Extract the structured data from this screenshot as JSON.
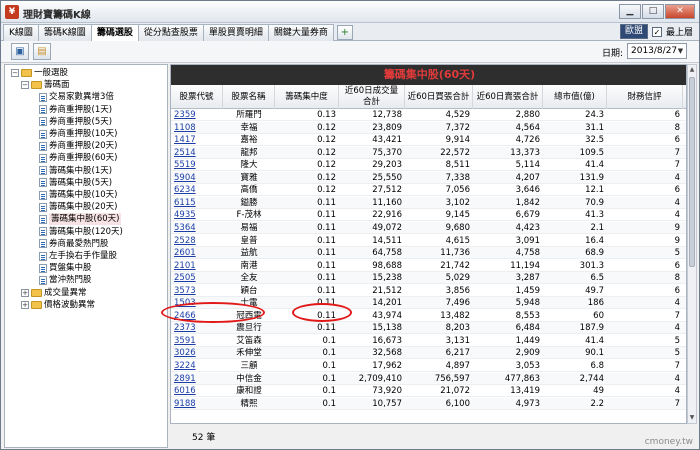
{
  "window": {
    "app_icon": "app-logo-icon",
    "title": "理財寶籌碼K線",
    "buttons": [
      "minimize-icon",
      "maximize-icon",
      "close-icon"
    ]
  },
  "tabbar": {
    "tabs": [
      "K線圖",
      "籌碼K線圖",
      "籌碼選股",
      "從分點查股票",
      "單股買賣明細",
      "關鍵大量券商"
    ],
    "active_tab_index": 2,
    "add_tab_icon": "add-tab-icon",
    "small_button": "歐盟",
    "topmost_checkbox": {
      "label": "最上層",
      "checked": true
    }
  },
  "toolbar": {
    "icons": [
      "save-icon",
      "open-folder-icon"
    ],
    "date_label": "日期:",
    "date_value": "2013/8/27"
  },
  "tree": {
    "rows": [
      {
        "label": "一般選股",
        "type": "folder",
        "expanded": true,
        "level": 0
      },
      {
        "label": "籌碼面",
        "type": "folder",
        "expanded": true,
        "level": 1
      },
      {
        "label": "交易家數異增3倍",
        "type": "leaf",
        "level": 2
      },
      {
        "label": "券商重押股(1天)",
        "type": "leaf",
        "level": 2
      },
      {
        "label": "券商重押股(5天)",
        "type": "leaf",
        "level": 2
      },
      {
        "label": "券商重押股(10天)",
        "type": "leaf",
        "level": 2
      },
      {
        "label": "券商重押股(20天)",
        "type": "leaf",
        "level": 2
      },
      {
        "label": "券商重押股(60天)",
        "type": "leaf",
        "level": 2
      },
      {
        "label": "籌碼集中股(1天)",
        "type": "leaf",
        "level": 2
      },
      {
        "label": "籌碼集中股(5天)",
        "type": "leaf",
        "level": 2
      },
      {
        "label": "籌碼集中股(10天)",
        "type": "leaf",
        "level": 2
      },
      {
        "label": "籌碼集中股(20天)",
        "type": "leaf",
        "level": 2
      },
      {
        "label": "籌碼集中股(60天)",
        "type": "leaf",
        "level": 2,
        "selected": true
      },
      {
        "label": "籌碼集中股(120天)",
        "type": "leaf",
        "level": 2
      },
      {
        "label": "券商最愛熱門股",
        "type": "leaf",
        "level": 2
      },
      {
        "label": "左手換右手作量股",
        "type": "leaf",
        "level": 2
      },
      {
        "label": "買盤集中股",
        "type": "leaf",
        "level": 2
      },
      {
        "label": "當沖熱門股",
        "type": "leaf",
        "level": 2
      },
      {
        "label": "成交量異常",
        "type": "folder",
        "expanded": false,
        "level": 1
      },
      {
        "label": "價格波動異常",
        "type": "folder",
        "expanded": false,
        "level": 1
      }
    ]
  },
  "grid": {
    "title": "籌碼集中股(60天)",
    "columns": [
      "股票代號",
      "股票名稱",
      "籌碼集中度",
      "近60日成交量合計",
      "近60日買張合計",
      "近60日賣張合計",
      "總市值(億)",
      "財務信評"
    ],
    "rows": [
      [
        "2359",
        "所羅門",
        "0.13",
        "12,738",
        "4,529",
        "2,880",
        "24.3",
        "6"
      ],
      [
        "1108",
        "幸福",
        "0.12",
        "23,809",
        "7,372",
        "4,564",
        "31.1",
        "8"
      ],
      [
        "1417",
        "嘉裕",
        "0.12",
        "43,421",
        "9,914",
        "4,726",
        "32.5",
        "6"
      ],
      [
        "2514",
        "龍邦",
        "0.12",
        "75,370",
        "22,572",
        "13,373",
        "109.5",
        "7"
      ],
      [
        "5519",
        "隆大",
        "0.12",
        "29,203",
        "8,511",
        "5,114",
        "41.4",
        "7"
      ],
      [
        "5904",
        "寶雅",
        "0.12",
        "25,550",
        "7,338",
        "4,207",
        "131.9",
        "4"
      ],
      [
        "6234",
        "高僑",
        "0.12",
        "27,512",
        "7,056",
        "3,646",
        "12.1",
        "6"
      ],
      [
        "6115",
        "鎰勝",
        "0.11",
        "11,160",
        "3,102",
        "1,842",
        "70.9",
        "4"
      ],
      [
        "4935",
        "F-茂林",
        "0.11",
        "22,916",
        "9,145",
        "6,679",
        "41.3",
        "4"
      ],
      [
        "5364",
        "易福",
        "0.11",
        "49,072",
        "9,680",
        "4,423",
        "2.1",
        "9"
      ],
      [
        "2528",
        "皇普",
        "0.11",
        "14,511",
        "4,615",
        "3,091",
        "16.4",
        "9"
      ],
      [
        "2601",
        "益航",
        "0.11",
        "64,758",
        "11,736",
        "4,758",
        "68.9",
        "5"
      ],
      [
        "2101",
        "南港",
        "0.11",
        "98,688",
        "21,742",
        "11,194",
        "301.3",
        "6"
      ],
      [
        "2505",
        "全友",
        "0.11",
        "15,238",
        "5,029",
        "3,287",
        "6.5",
        "8"
      ],
      [
        "3573",
        "穎台",
        "0.11",
        "21,512",
        "3,856",
        "1,459",
        "49.7",
        "6"
      ],
      [
        "1503",
        "士電",
        "0.11",
        "14,201",
        "7,496",
        "5,948",
        "186",
        "4"
      ],
      [
        "2466",
        "冠西電",
        "0.11",
        "43,974",
        "13,482",
        "8,553",
        "60",
        "7"
      ],
      [
        "2373",
        "震旦行",
        "0.11",
        "15,138",
        "8,203",
        "6,484",
        "187.9",
        "4"
      ],
      [
        "3591",
        "艾笛森",
        "0.1",
        "16,673",
        "3,131",
        "1,449",
        "41.4",
        "5"
      ],
      [
        "3026",
        "禾伸堂",
        "0.1",
        "32,568",
        "6,217",
        "2,909",
        "90.1",
        "5"
      ],
      [
        "3224",
        "三顧",
        "0.1",
        "17,962",
        "4,897",
        "3,053",
        "6.8",
        "7"
      ],
      [
        "2891",
        "中信金",
        "0.1",
        "2,709,410",
        "756,597",
        "477,863",
        "2,744",
        "4"
      ],
      [
        "6016",
        "康和證",
        "0.1",
        "73,920",
        "21,072",
        "13,419",
        "49",
        "4"
      ],
      [
        "9188",
        "精熙",
        "0.1",
        "10,757",
        "6,100",
        "4,973",
        "2.2",
        "7"
      ]
    ],
    "highlighted_row_index": 15,
    "count_text": "52 筆"
  },
  "watermark": "cmoney.tw",
  "colors": {
    "grid_title_bg": "#2e2e2e",
    "grid_title_text": "#e03a3a",
    "annotation": "#e11919",
    "link": "#1c3ea6"
  }
}
